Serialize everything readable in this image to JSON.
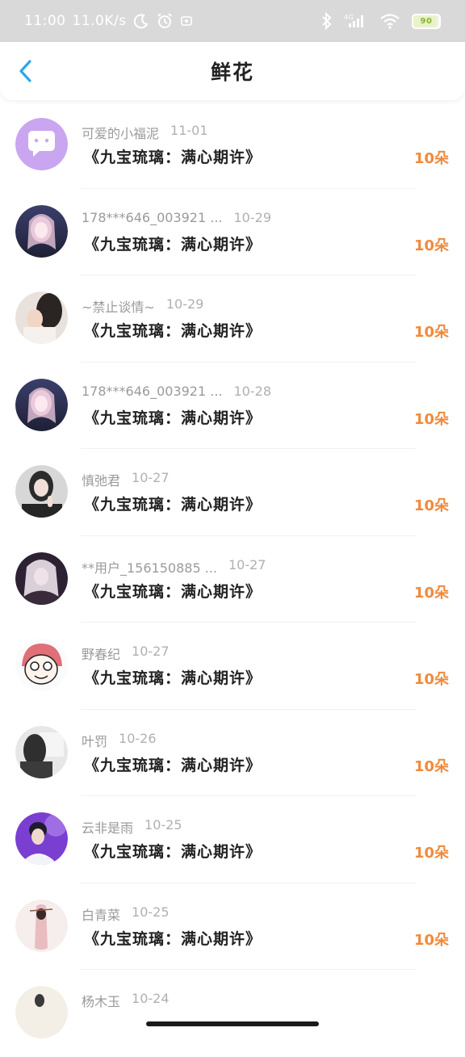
{
  "status_bar": {
    "time": "11:00",
    "speed": "11.0K/s",
    "network": "4G",
    "battery": "90"
  },
  "header": {
    "title": "鲜花"
  },
  "colors": {
    "accent": "#2ea7e8",
    "count": "#f08a3c"
  },
  "records": [
    {
      "name": "可爱的小福泥",
      "date": "11-01",
      "gift": "《九宝琉璃：满心期许》",
      "count": "10朵"
    },
    {
      "name": "178***646_003921 ...",
      "date": "10-29",
      "gift": "《九宝琉璃：满心期许》",
      "count": "10朵"
    },
    {
      "name": "~禁止谈情~",
      "date": "10-29",
      "gift": "《九宝琉璃：满心期许》",
      "count": "10朵"
    },
    {
      "name": "178***646_003921 ...",
      "date": "10-28",
      "gift": "《九宝琉璃：满心期许》",
      "count": "10朵"
    },
    {
      "name": "慎弛君",
      "date": "10-27",
      "gift": "《九宝琉璃：满心期许》",
      "count": "10朵"
    },
    {
      "name": "**用户_156150885 ...",
      "date": "10-27",
      "gift": "《九宝琉璃：满心期许》",
      "count": "10朵"
    },
    {
      "name": "野春纪",
      "date": "10-27",
      "gift": "《九宝琉璃：满心期许》",
      "count": "10朵"
    },
    {
      "name": "叶罚",
      "date": "10-26",
      "gift": "《九宝琉璃：满心期许》",
      "count": "10朵"
    },
    {
      "name": "云非是雨",
      "date": "10-25",
      "gift": "《九宝琉璃：满心期许》",
      "count": "10朵"
    },
    {
      "name": "白青菜",
      "date": "10-25",
      "gift": "《九宝琉璃：满心期许》",
      "count": "10朵"
    },
    {
      "name": "杨木玉",
      "date": "10-24",
      "gift": "",
      "count": ""
    }
  ]
}
